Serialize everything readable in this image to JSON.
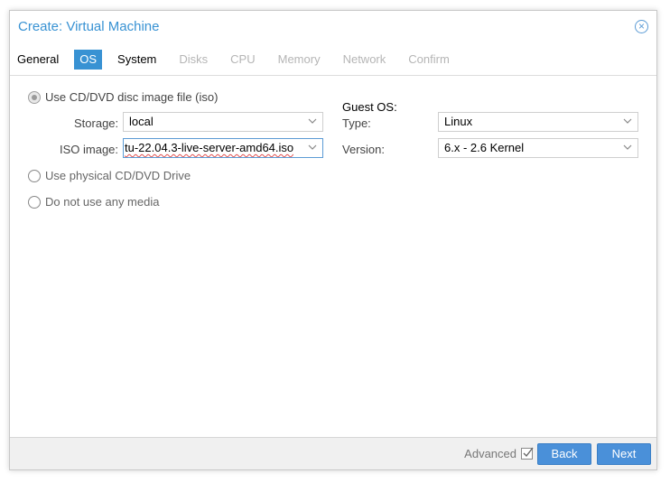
{
  "window": {
    "title": "Create: Virtual Machine",
    "close_icon": "close-circle-icon"
  },
  "tabs": [
    {
      "label": "General",
      "state": "normal"
    },
    {
      "label": "OS",
      "state": "active"
    },
    {
      "label": "System",
      "state": "normal"
    },
    {
      "label": "Disks",
      "state": "disabled"
    },
    {
      "label": "CPU",
      "state": "disabled"
    },
    {
      "label": "Memory",
      "state": "disabled"
    },
    {
      "label": "Network",
      "state": "disabled"
    },
    {
      "label": "Confirm",
      "state": "disabled"
    }
  ],
  "media": {
    "option_iso": "Use CD/DVD disc image file (iso)",
    "storage_label": "Storage:",
    "storage_value": "local",
    "iso_label": "ISO image:",
    "iso_value": "tu-22.04.3-live-server-amd64.iso",
    "option_physical": "Use physical CD/DVD Drive",
    "option_none": "Do not use any media",
    "selected": "iso"
  },
  "guest": {
    "title": "Guest OS:",
    "type_label": "Type:",
    "type_value": "Linux",
    "version_label": "Version:",
    "version_value": "6.x - 2.6 Kernel"
  },
  "footer": {
    "advanced_label": "Advanced",
    "advanced_checked": true,
    "back_label": "Back",
    "next_label": "Next"
  },
  "colors": {
    "accent": "#3892d3",
    "button": "#4a90d9"
  }
}
